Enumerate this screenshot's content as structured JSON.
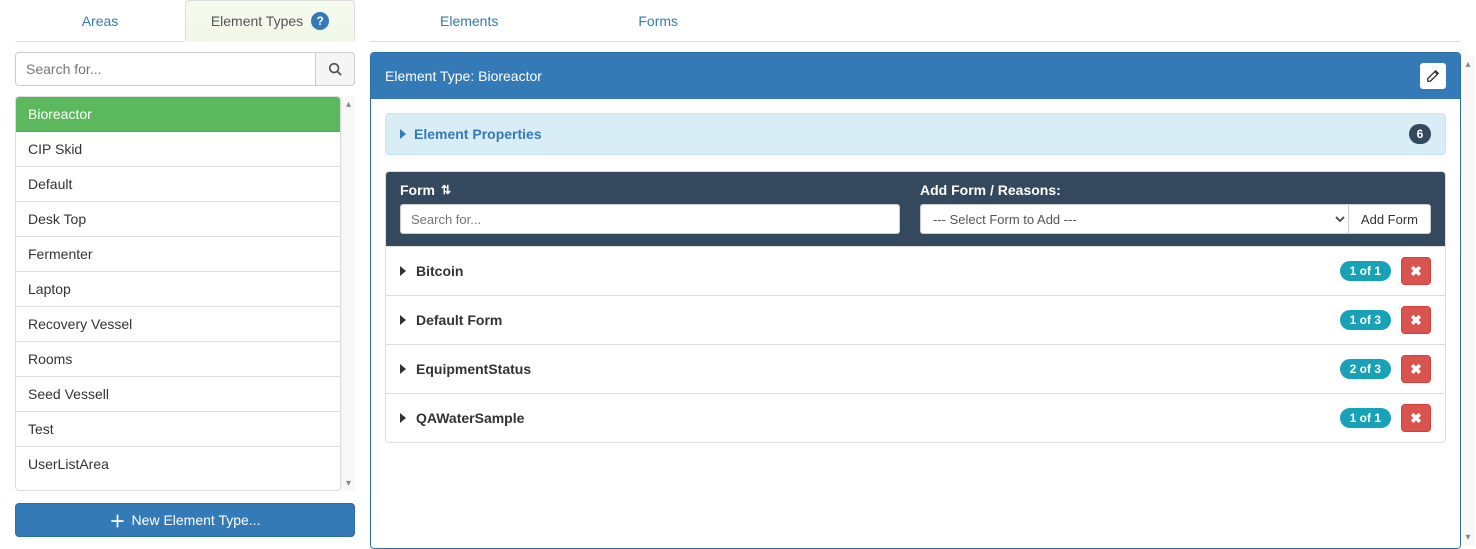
{
  "left": {
    "tabs": [
      {
        "label": "Areas",
        "active": false
      },
      {
        "label": "Element Types",
        "active": true
      }
    ],
    "search_placeholder": "Search for...",
    "items": [
      {
        "label": "Bioreactor",
        "active": true
      },
      {
        "label": "CIP Skid",
        "active": false
      },
      {
        "label": "Default",
        "active": false
      },
      {
        "label": "Desk Top",
        "active": false
      },
      {
        "label": "Fermenter",
        "active": false
      },
      {
        "label": "Laptop",
        "active": false
      },
      {
        "label": "Recovery Vessel",
        "active": false
      },
      {
        "label": "Rooms",
        "active": false
      },
      {
        "label": "Seed Vessell",
        "active": false
      },
      {
        "label": "Test",
        "active": false
      },
      {
        "label": "UserListArea",
        "active": false
      }
    ],
    "new_button": "New Element Type..."
  },
  "right": {
    "tabs": [
      {
        "label": "Elements"
      },
      {
        "label": "Forms"
      }
    ],
    "header_title": "Element Type: Bioreactor",
    "properties": {
      "label": "Element Properties",
      "count": "6"
    },
    "form_section": {
      "col1_label": "Form",
      "col1_placeholder": "Search for...",
      "col2_label": "Add Form / Reasons:",
      "select_placeholder": "--- Select Form to Add ---",
      "add_button": "Add Form"
    },
    "forms": [
      {
        "name": "Bitcoin",
        "count": "1 of 1"
      },
      {
        "name": "Default Form",
        "count": "1 of 3"
      },
      {
        "name": "EquipmentStatus",
        "count": "2 of 3"
      },
      {
        "name": "QAWaterSample",
        "count": "1 of 1"
      }
    ]
  }
}
